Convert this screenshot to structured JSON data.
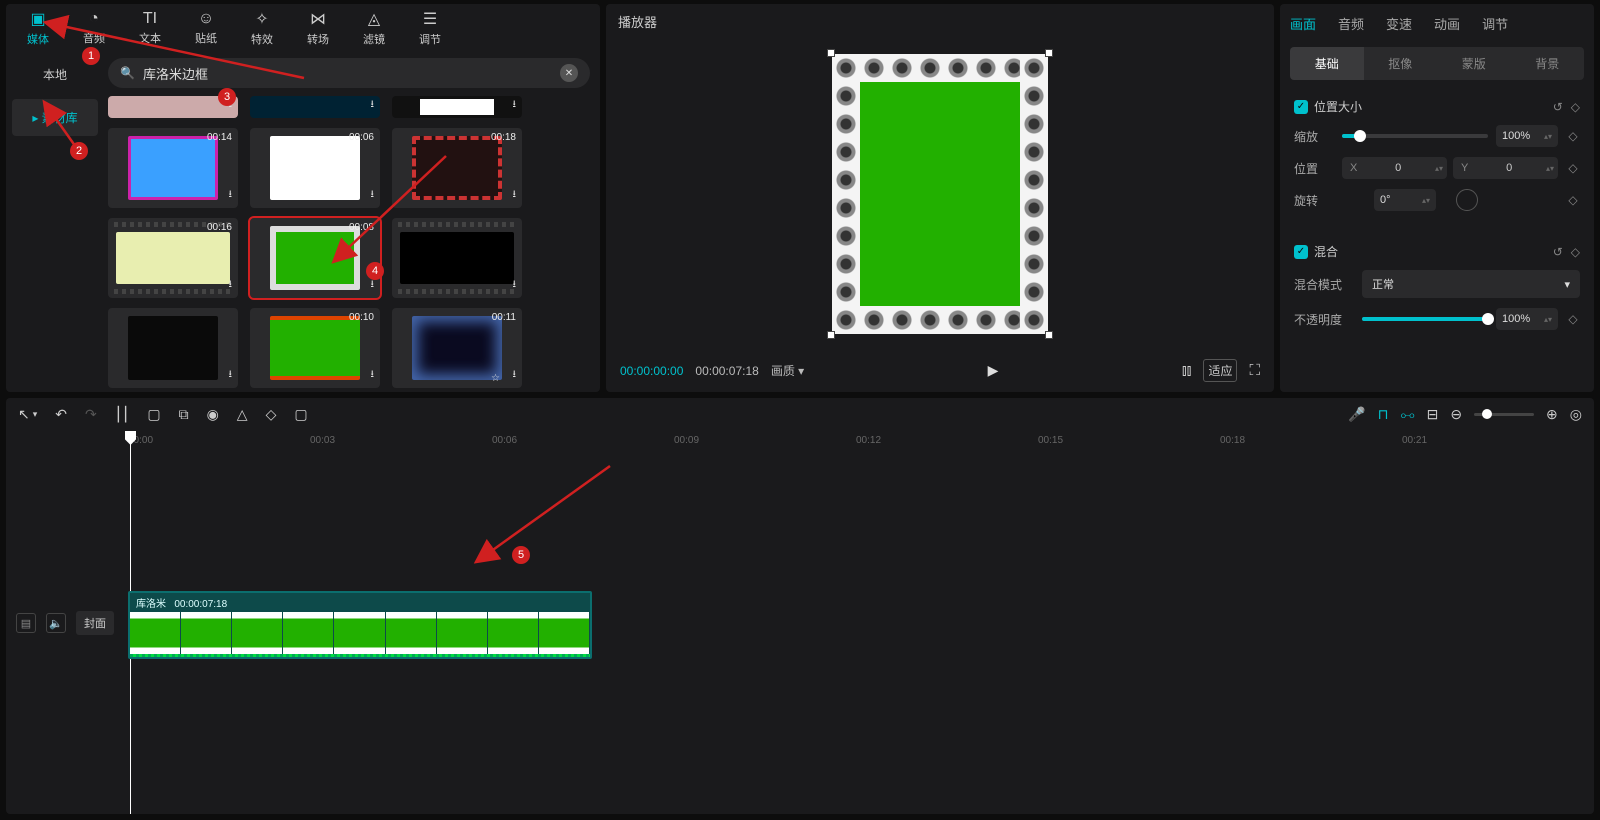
{
  "top_tabs": {
    "media": "媒体",
    "audio": "音频",
    "text": "文本",
    "sticker": "贴纸",
    "effect": "特效",
    "transition": "转场",
    "filter": "滤镜",
    "adjust": "调节"
  },
  "left_nav": {
    "local": "本地",
    "library": "素材库"
  },
  "search": {
    "placeholder": "",
    "value": "库洛米边框"
  },
  "assets": [
    {
      "dur": ""
    },
    {
      "dur": ""
    },
    {
      "dur": ""
    },
    {
      "dur": "00:14"
    },
    {
      "dur": "00:06"
    },
    {
      "dur": "00:18"
    },
    {
      "dur": "00:16"
    },
    {
      "dur": "00:08"
    },
    {
      "dur": ""
    },
    {
      "dur": ""
    },
    {
      "dur": "00:10"
    },
    {
      "dur": "00:11"
    }
  ],
  "player": {
    "title": "播放器",
    "time_current": "00:00:00:00",
    "time_total": "00:00:07:18",
    "quality": "画质 ▾",
    "fit": "适应"
  },
  "right": {
    "tabs": {
      "picture": "画面",
      "audio": "音频",
      "speed": "变速",
      "anim": "动画",
      "adjust": "调节"
    },
    "subtabs": {
      "basic": "基础",
      "mask": "抠像",
      "matte": "蒙版",
      "bg": "背景"
    },
    "section_size": "位置大小",
    "scale_label": "缩放",
    "scale_value": "100%",
    "pos_label": "位置",
    "pos_x": "0",
    "pos_y": "0",
    "rot_label": "旋转",
    "rot_value": "0°",
    "section_blend": "混合",
    "blend_mode_label": "混合模式",
    "blend_mode_value": "正常",
    "opacity_label": "不透明度",
    "opacity_value": "100%"
  },
  "timeline": {
    "ticks": [
      "00:00",
      "00:03",
      "00:06",
      "00:09",
      "00:12",
      "00:15",
      "00:18",
      "00:21"
    ],
    "cover": "封面",
    "clip_name": "库洛米",
    "clip_dur": "00:00:07:18"
  },
  "annotations": [
    "1",
    "2",
    "3",
    "4",
    "5"
  ]
}
